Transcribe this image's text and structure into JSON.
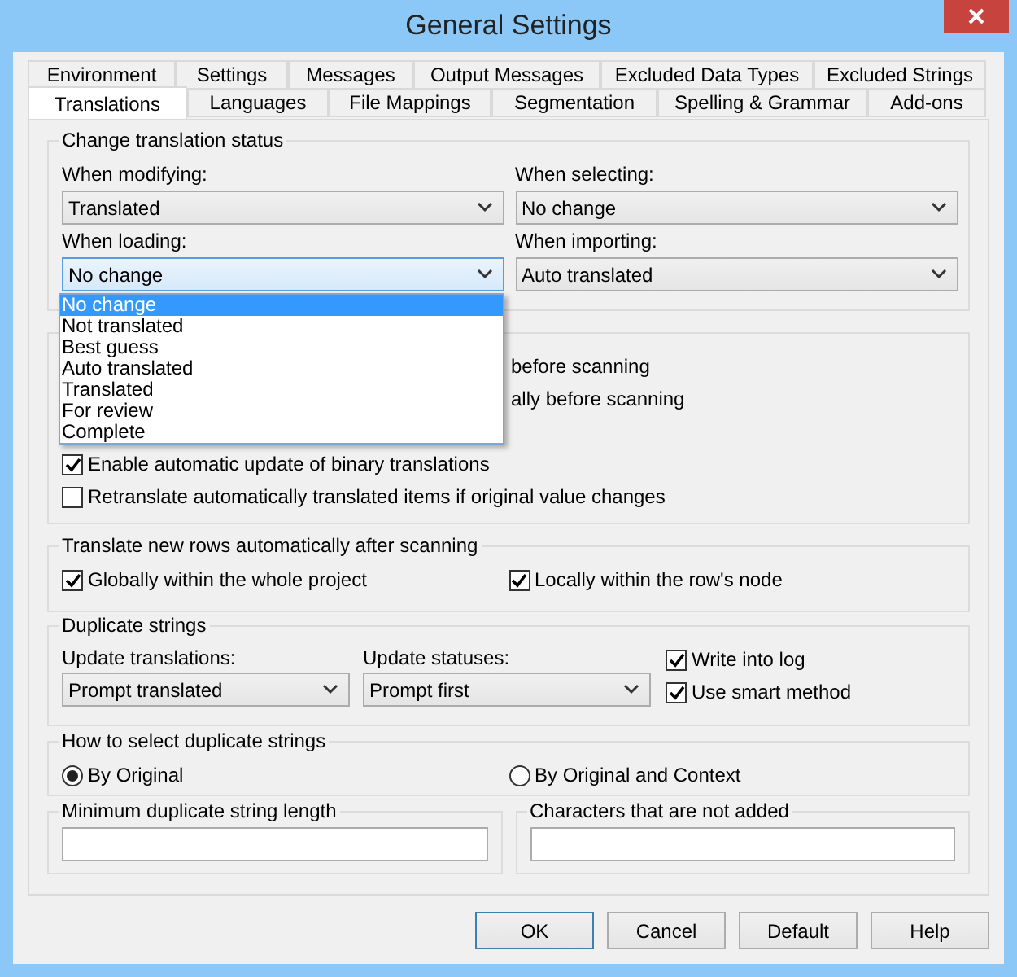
{
  "window": {
    "title": "General Settings"
  },
  "tab_rows": [
    [
      {
        "label": "Environment",
        "selected": false
      },
      {
        "label": "Settings",
        "selected": false
      },
      {
        "label": "Messages",
        "selected": false
      },
      {
        "label": "Output Messages",
        "selected": false
      },
      {
        "label": "Excluded Data Types",
        "selected": false
      },
      {
        "label": "Excluded Strings",
        "selected": false
      }
    ],
    [
      {
        "label": "Translations",
        "selected": true
      },
      {
        "label": "Languages",
        "selected": false
      },
      {
        "label": "File Mappings",
        "selected": false
      },
      {
        "label": "Segmentation",
        "selected": false
      },
      {
        "label": "Spelling & Grammar",
        "selected": false
      },
      {
        "label": "Add-ons",
        "selected": false
      }
    ]
  ],
  "change_status": {
    "title": "Change translation status",
    "fields": [
      {
        "label": "When modifying:",
        "value": "Translated",
        "expanded": false
      },
      {
        "label": "When selecting:",
        "value": "No change",
        "expanded": false
      },
      {
        "label": "When loading:",
        "value": "No change",
        "expanded": true,
        "options": [
          {
            "label": "No change",
            "selected": true
          },
          {
            "label": "Not translated",
            "selected": false
          },
          {
            "label": "Best guess",
            "selected": false
          },
          {
            "label": "Auto translated",
            "selected": false
          },
          {
            "label": "Translated",
            "selected": false
          },
          {
            "label": "For review",
            "selected": false
          },
          {
            "label": "Complete",
            "selected": false
          }
        ]
      },
      {
        "label": "When importing:",
        "value": "Auto translated",
        "expanded": false
      }
    ]
  },
  "scan_options": {
    "partial_texts": [
      "before scanning",
      "ally before scanning"
    ],
    "checkboxes": [
      {
        "label": "Enable automatic update of binary translations",
        "checked": true
      },
      {
        "label": "Retranslate automatically translated items if original value changes",
        "checked": false
      }
    ]
  },
  "translate_new_rows": {
    "title": "Translate new rows automatically after scanning",
    "checkboxes": [
      {
        "label": "Globally within the whole project",
        "checked": true
      },
      {
        "label": "Locally within the row's node",
        "checked": true
      }
    ]
  },
  "duplicate_strings": {
    "title": "Duplicate strings",
    "fields": [
      {
        "label": "Update translations:",
        "value": "Prompt translated"
      },
      {
        "label": "Update statuses:",
        "value": "Prompt first"
      }
    ],
    "checkboxes": [
      {
        "label": "Write into log",
        "checked": true
      },
      {
        "label": "Use smart method",
        "checked": true
      }
    ]
  },
  "select_duplicates": {
    "title": "How to select duplicate strings",
    "radios": [
      {
        "label": "By Original",
        "selected": true
      },
      {
        "label": "By Original and Context",
        "selected": false
      }
    ]
  },
  "text_fields": [
    {
      "title": "Minimum duplicate string length"
    },
    {
      "title": "Characters that are not added"
    }
  ],
  "buttons": [
    {
      "label": "OK",
      "default": true
    },
    {
      "label": "Cancel",
      "default": false
    },
    {
      "label": "Default",
      "default": false
    },
    {
      "label": "Help",
      "default": false
    }
  ]
}
